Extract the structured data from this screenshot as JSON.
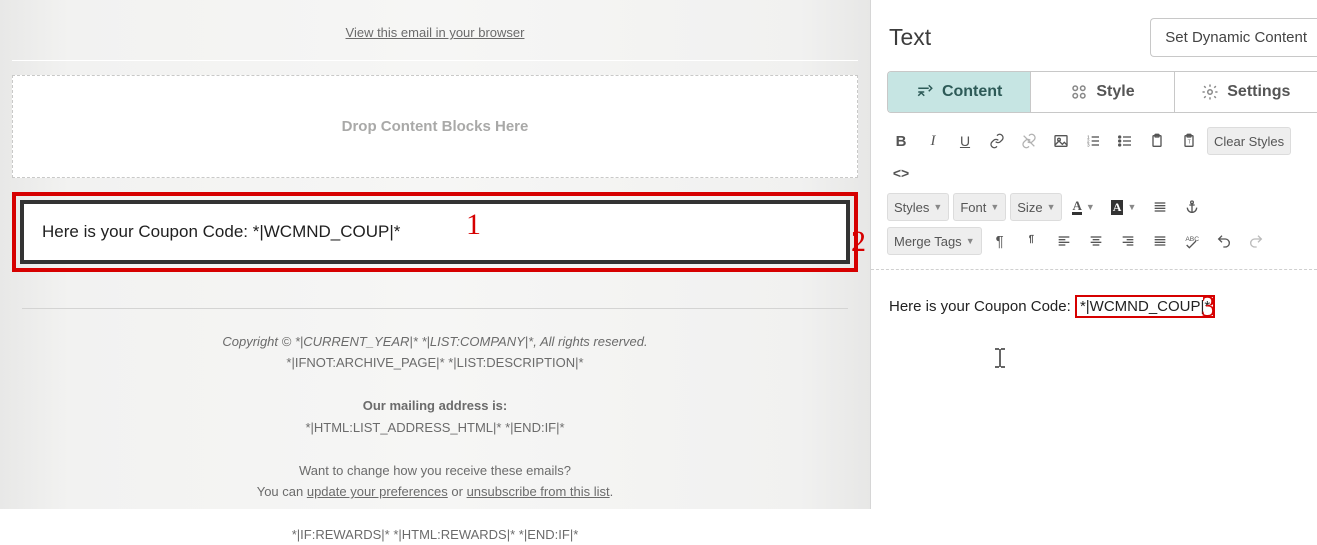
{
  "canvas": {
    "view_in_browser": "View this email in your browser",
    "drop_zone": "Drop Content Blocks Here",
    "coupon_line": "Here is your Coupon Code: *|WCMND_COUP|*",
    "footer": {
      "copyright": "Copyright © *|CURRENT_YEAR|* *|LIST:COMPANY|*, All rights reserved.",
      "ifnot": "*|IFNOT:ARCHIVE_PAGE|* *|LIST:DESCRIPTION|*",
      "mailing_hdr": "Our mailing address is:",
      "mailing": "*|HTML:LIST_ADDRESS_HTML|* *|END:IF|*",
      "change": "Want to change how you receive these emails?",
      "you_can": "You can ",
      "update_link": "update your preferences",
      "or": " or ",
      "unsub_link": "unsubscribe from this list",
      "period": ".",
      "rewards": "*|IF:REWARDS|* *|HTML:REWARDS|* *|END:IF|*"
    }
  },
  "panel": {
    "title": "Text",
    "dynamic_btn": "Set Dynamic Content",
    "tabs": {
      "content": "Content",
      "style": "Style",
      "settings": "Settings"
    },
    "toolbar": {
      "styles": "Styles",
      "font": "Font",
      "size": "Size",
      "merge": "Merge Tags",
      "clear": "Clear Styles"
    },
    "editor": {
      "prefix": "Here is your Coupon Code: ",
      "tag": "*|WCMND_COUP|*"
    }
  },
  "annotations": {
    "one": "1",
    "two": "2",
    "three": "3"
  }
}
